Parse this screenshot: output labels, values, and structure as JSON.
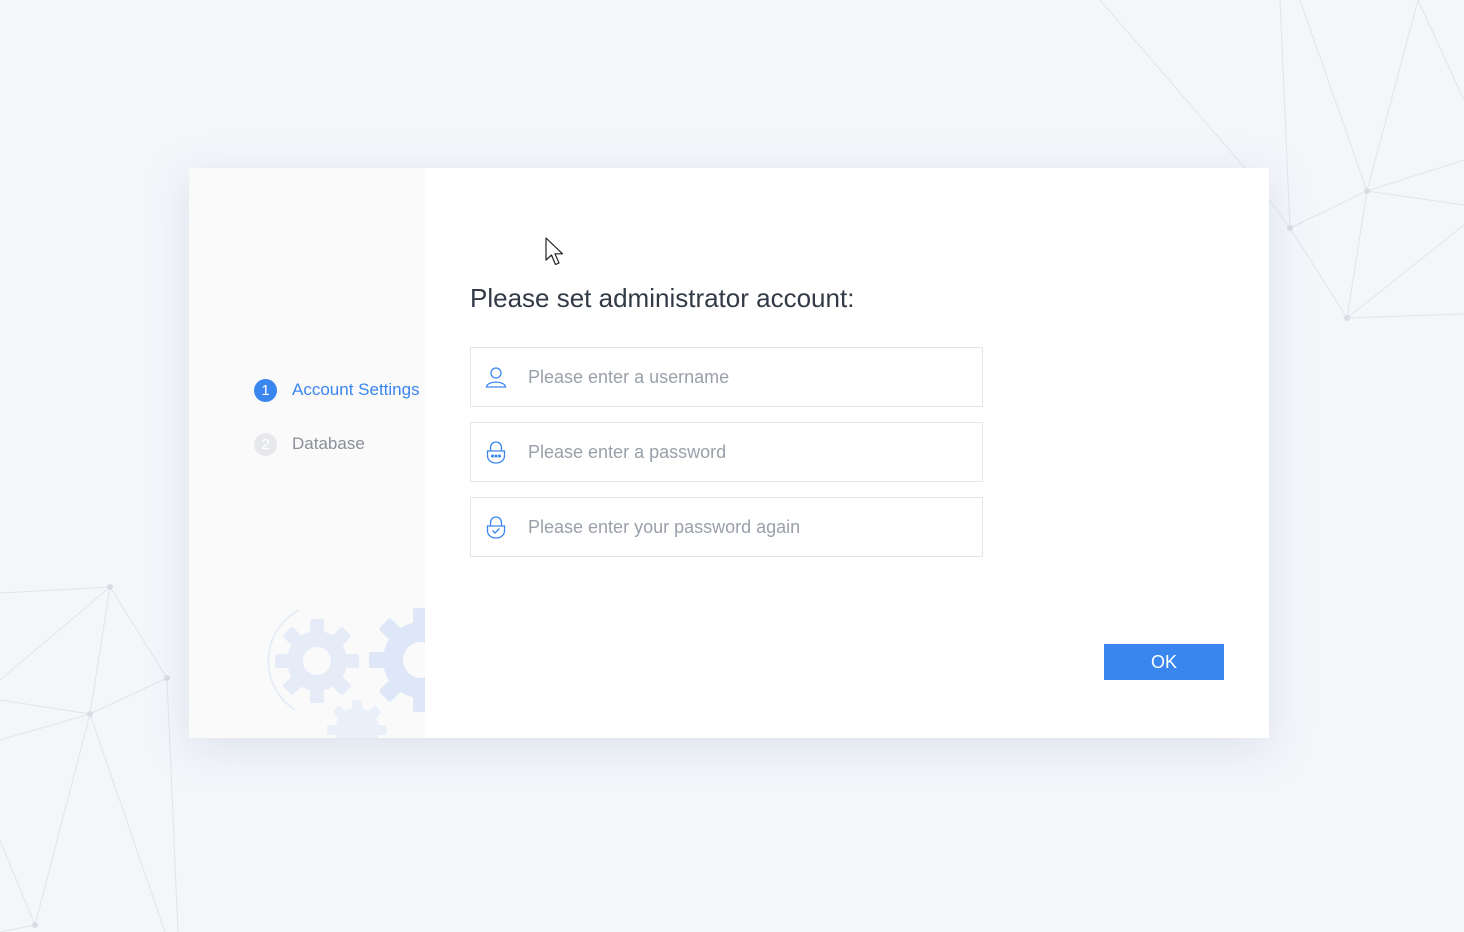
{
  "sidebar": {
    "steps": [
      {
        "number": "1",
        "label": "Account Settings",
        "state": "active"
      },
      {
        "number": "2",
        "label": "Database",
        "state": "inactive"
      }
    ]
  },
  "main": {
    "title": "Please set administrator account:",
    "fields": [
      {
        "icon": "user-icon",
        "placeholder": "Please enter a username",
        "value": ""
      },
      {
        "icon": "lock-dots-icon",
        "placeholder": "Please enter a password",
        "value": ""
      },
      {
        "icon": "lock-check-icon",
        "placeholder": "Please enter your password again",
        "value": ""
      }
    ],
    "ok_label": "OK"
  },
  "colors": {
    "accent": "#3a86ef",
    "background": "#f4f6fa",
    "sidebar": "#fafafa",
    "gears": "#e8eef8"
  }
}
